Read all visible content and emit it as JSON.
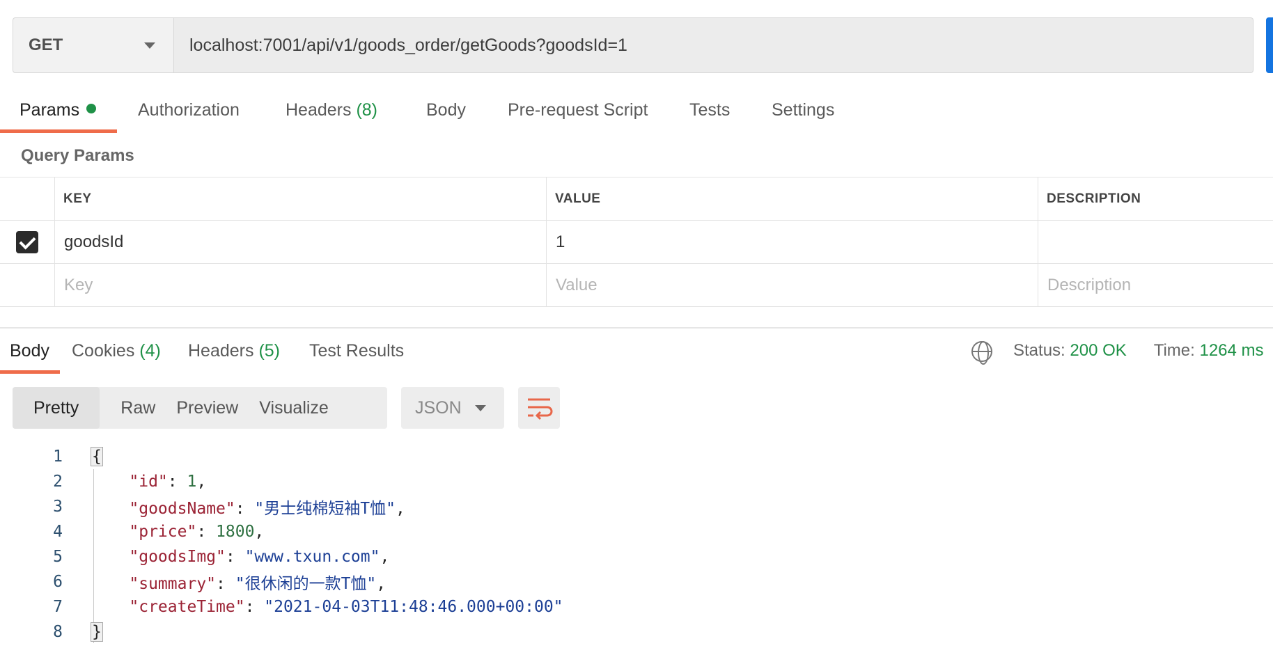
{
  "request": {
    "method": "GET",
    "url": "localhost:7001/api/v1/goods_order/getGoods?goodsId=1"
  },
  "request_tabs": {
    "params": "Params",
    "authorization": "Authorization",
    "headers": "Headers",
    "headers_count": "(8)",
    "body": "Body",
    "pre_request": "Pre-request Script",
    "tests": "Tests",
    "settings": "Settings"
  },
  "query_params": {
    "title": "Query Params",
    "columns": [
      "KEY",
      "VALUE",
      "DESCRIPTION"
    ],
    "rows": [
      {
        "checked": true,
        "key": "goodsId",
        "value": "1",
        "description": ""
      }
    ],
    "placeholders": {
      "key": "Key",
      "value": "Value",
      "description": "Description"
    }
  },
  "response_tabs": {
    "body": "Body",
    "cookies": "Cookies",
    "cookies_count": "(4)",
    "headers": "Headers",
    "headers_count": "(5)",
    "test_results": "Test Results"
  },
  "status": {
    "status_label": "Status:",
    "status_value": "200 OK",
    "time_label": "Time:",
    "time_value": "1264 ms"
  },
  "view": {
    "modes": [
      "Pretty",
      "Raw",
      "Preview",
      "Visualize"
    ],
    "active_mode": "Pretty",
    "format": "JSON"
  },
  "code": {
    "line_numbers": [
      "1",
      "2",
      "3",
      "4",
      "5",
      "6",
      "7",
      "8"
    ],
    "open_brace": "{",
    "close_brace": "}",
    "fields": [
      {
        "key": "\"id\"",
        "value": "1",
        "type": "number"
      },
      {
        "key": "\"goodsName\"",
        "value": "\"男士纯棉短袖T恤\"",
        "type": "string"
      },
      {
        "key": "\"price\"",
        "value": "1800",
        "type": "number"
      },
      {
        "key": "\"goodsImg\"",
        "value": "\"www.txun.com\"",
        "type": "string"
      },
      {
        "key": "\"summary\"",
        "value": "\"很休闲的一款T恤\"",
        "type": "string"
      },
      {
        "key": "\"createTime\"",
        "value": "\"2021-04-03T11:48:46.000+00:00\"",
        "type": "string"
      }
    ]
  },
  "colors": {
    "accent_underline": "#ef6c4a",
    "success_green": "#1f9147",
    "send_blue": "#1474e0"
  }
}
